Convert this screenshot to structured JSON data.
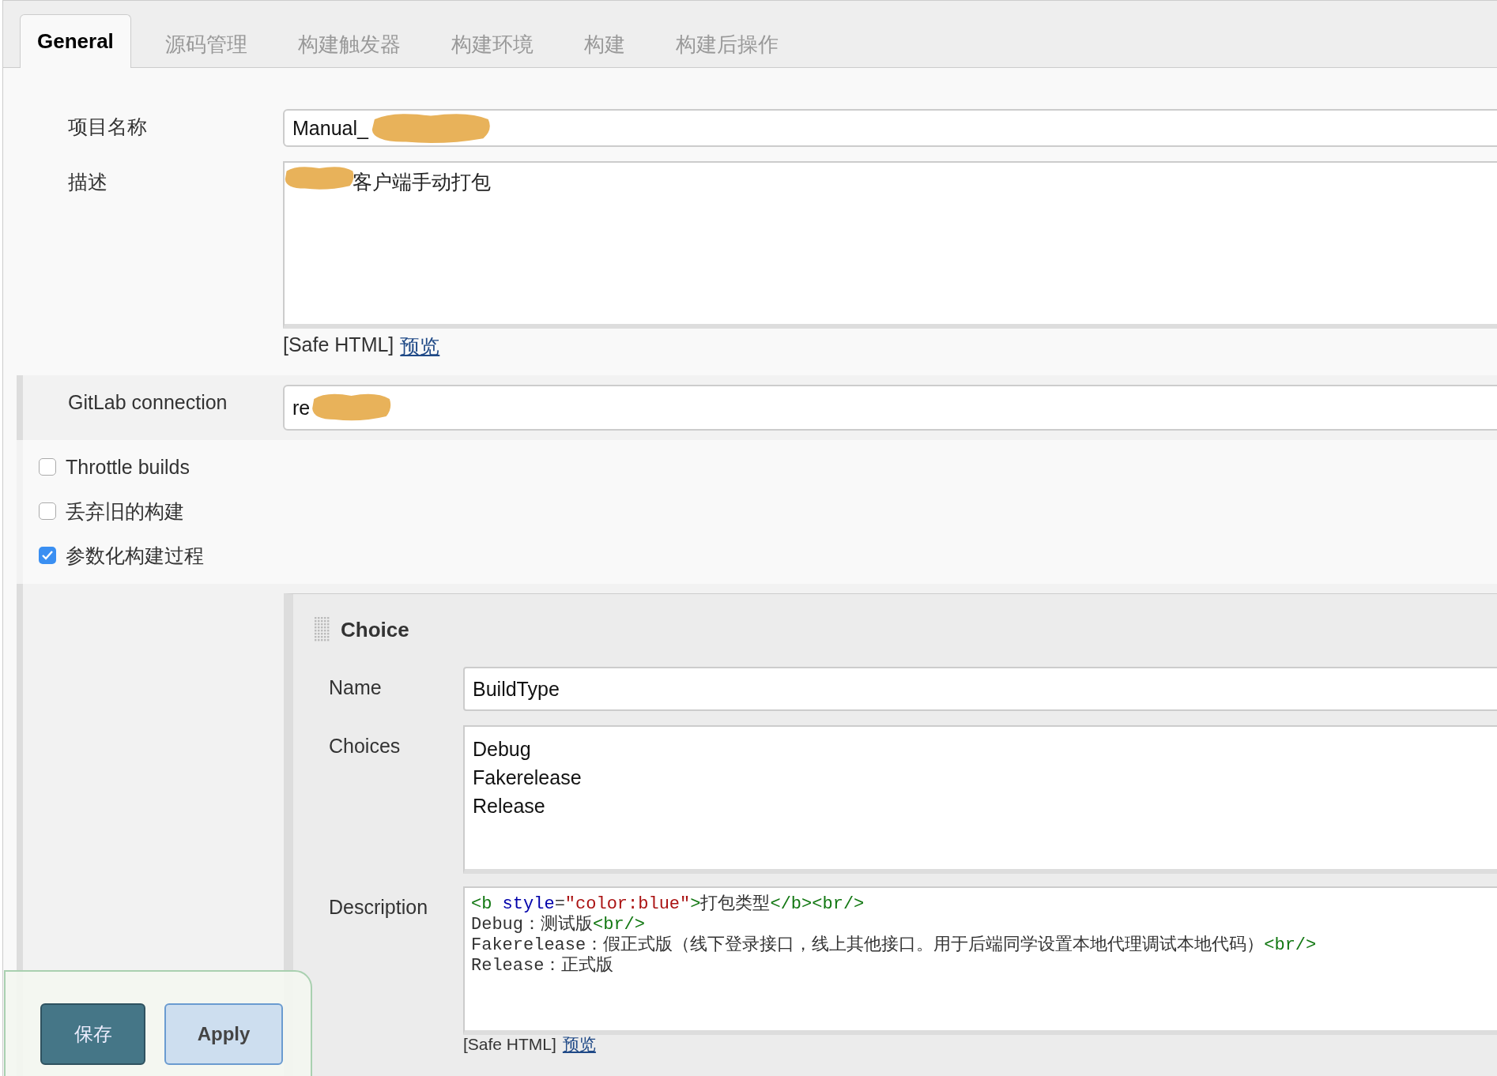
{
  "tabs": [
    {
      "label": "General",
      "selected": true
    },
    {
      "label": "源码管理",
      "selected": false
    },
    {
      "label": "构建触发器",
      "selected": false
    },
    {
      "label": "构建环境",
      "selected": false
    },
    {
      "label": "构建",
      "selected": false
    },
    {
      "label": "构建后操作",
      "selected": false
    }
  ],
  "project_name": {
    "label": "项目名称",
    "value": "Manual_"
  },
  "description": {
    "label": "描述",
    "value": "客户端手动打包",
    "note": "[Safe HTML]",
    "preview_link": "预览"
  },
  "gitlab_connection": {
    "label": "GitLab connection",
    "value": "re"
  },
  "options": [
    {
      "label": "Throttle builds",
      "checked": false
    },
    {
      "label": "丢弃旧的构建",
      "checked": false
    },
    {
      "label": "参数化构建过程",
      "checked": true
    }
  ],
  "parameter": {
    "title": "Choice",
    "name_label": "Name",
    "name_value": "BuildType",
    "choices_label": "Choices",
    "choices": [
      "Debug",
      "Fakerelease",
      "Release"
    ],
    "description_label": "Description",
    "description_lines": [
      [
        {
          "kind": "tag",
          "text": "<b "
        },
        {
          "kind": "attr",
          "text": "style"
        },
        {
          "kind": "text",
          "text": "="
        },
        {
          "kind": "string",
          "text": "\"color:blue\""
        },
        {
          "kind": "tag",
          "text": ">"
        },
        {
          "kind": "text",
          "text": "打包类型"
        },
        {
          "kind": "tag",
          "text": "</b><br/>"
        }
      ],
      [
        {
          "kind": "text",
          "text": "Debug：测试版"
        },
        {
          "kind": "tag",
          "text": "<br/>"
        }
      ],
      [
        {
          "kind": "text",
          "text": "Fakerelease：假正式版（线下登录接口，线上其他接口。用于后端同学设置本地代理调试本地代码）"
        },
        {
          "kind": "tag",
          "text": "<br/>"
        }
      ],
      [
        {
          "kind": "text",
          "text": "Release：正式版"
        }
      ]
    ],
    "note": "[Safe HTML]",
    "preview_link": "预览"
  },
  "buttons": [
    {
      "label": "保存",
      "kind": "primary"
    },
    {
      "label": "Apply",
      "kind": "secondary"
    }
  ]
}
